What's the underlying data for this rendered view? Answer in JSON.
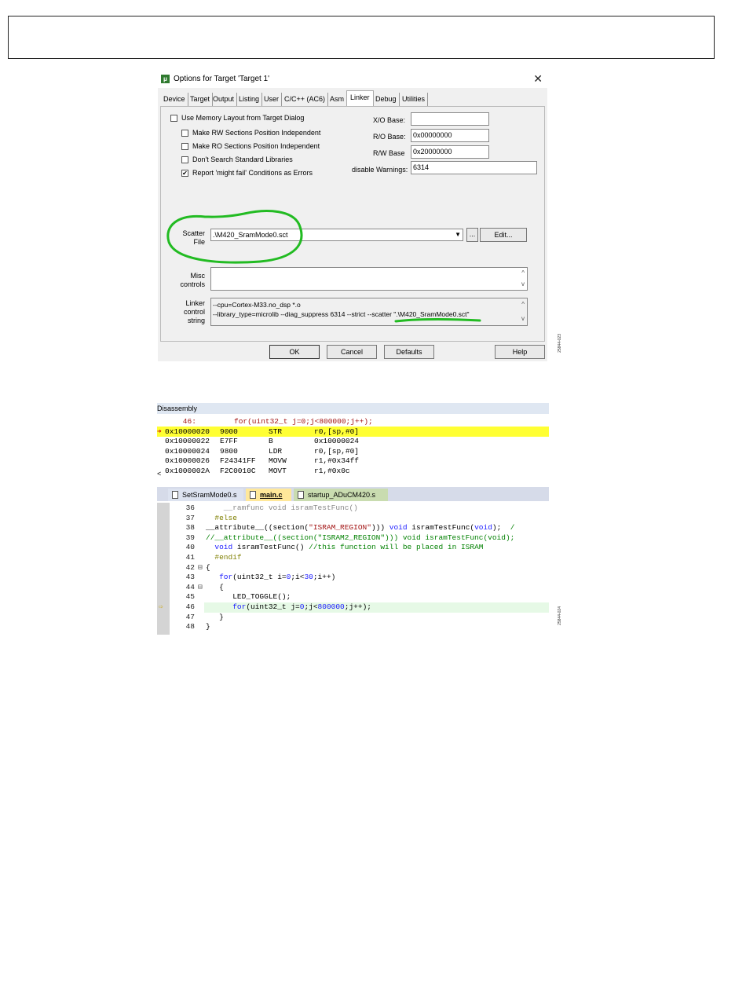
{
  "dialog": {
    "title": "Options for Target 'Target 1'",
    "close_glyph": "✕",
    "tabs": [
      "Device",
      "Target",
      "Output",
      "Listing",
      "User",
      "C/C++ (AC6)",
      "Asm",
      "Linker",
      "Debug",
      "Utilities"
    ],
    "active_tab": "Linker",
    "checkboxes": [
      {
        "label": "Use Memory Layout from Target Dialog",
        "checked": false
      },
      {
        "label": "Make RW Sections Position Independent",
        "checked": false
      },
      {
        "label": "Make RO Sections Position Independent",
        "checked": false
      },
      {
        "label": "Don't Search Standard Libraries",
        "checked": false
      },
      {
        "label": "Report 'might fail' Conditions as Errors",
        "checked": true
      }
    ],
    "check_glyph": "✔",
    "xo_base_label": "X/O Base:",
    "xo_base_value": "",
    "ro_base_label": "R/O Base:",
    "ro_base_value": "0x00000000",
    "rw_base_label": "R/W Base",
    "rw_base_value": "0x20000000",
    "disable_warnings_label": "disable Warnings:",
    "disable_warnings_value": "6314",
    "scatter_label_1": "Scatter",
    "scatter_label_2": "File",
    "scatter_value": ".\\M420_SramMode0.sct",
    "browse_label": "...",
    "edit_label": "Edit...",
    "misc_label_1": "Misc",
    "misc_label_2": "controls",
    "linker_label_1": "Linker",
    "linker_label_2": "control",
    "linker_label_3": "string",
    "linker_line_1": "--cpu=Cortex-M33.no_dsp *.o",
    "linker_line_2": "--library_type=microlib --diag_suppress 6314 --strict --scatter \".\\M420_SramMode0.sct\"",
    "ok_label": "OK",
    "cancel_label": "Cancel",
    "defaults_label": "Defaults",
    "help_label": "Help",
    "annotation_color": "#22bb22"
  },
  "fig_code_1": "25844-023",
  "disassembly": {
    "title": "Disassembly",
    "rows": [
      {
        "addr": "    46:",
        "hex": "",
        "op": "for(uint32_t j=0;j<800000;j++);",
        "arg": "",
        "source": true
      },
      {
        "addr": "0x10000020",
        "hex": "9000",
        "op": "STR",
        "arg": "r0,[sp,#0]",
        "current": true
      },
      {
        "addr": "0x10000022",
        "hex": "E7FF",
        "op": "B",
        "arg": "0x10000024"
      },
      {
        "addr": "0x10000024",
        "hex": "9800",
        "op": "LDR",
        "arg": "r0,[sp,#0]"
      },
      {
        "addr": "0x10000026",
        "hex": "F24341FF",
        "op": "MOVW",
        "arg": "r1,#0x34ff"
      },
      {
        "addr": "0x1000002A",
        "hex": "F2C0010C",
        "op": "MOVT",
        "arg": "r1,#0x0c"
      }
    ],
    "scroll_left_glyph": "<"
  },
  "editor": {
    "tabs": [
      {
        "label": "SetSramMode0.s",
        "active": false
      },
      {
        "label": "main.c",
        "active": true
      },
      {
        "label": "startup_ADuCM420.s",
        "active": false
      }
    ],
    "lines": [
      {
        "n": "36",
        "fold": "",
        "code": [
          [
            "gray",
            "    __ramfunc "
          ],
          [
            "gray",
            "void "
          ],
          [
            "gray",
            "isramTestFunc()"
          ]
        ]
      },
      {
        "n": "37",
        "fold": "",
        "code": [
          [
            "pp",
            "  #else"
          ]
        ]
      },
      {
        "n": "38",
        "fold": "",
        "code": [
          [
            "",
            "__attribute__((section("
          ],
          [
            "str",
            "\"ISRAM_REGION\""
          ],
          [
            "",
            ")))"
          ],
          [
            "kw",
            " void"
          ],
          [
            "",
            " isramTestFunc("
          ],
          [
            "kw",
            "void"
          ],
          [
            "",
            ");  "
          ],
          [
            "cm",
            "/"
          ]
        ]
      },
      {
        "n": "39",
        "fold": "",
        "code": [
          [
            "cm",
            "//__attribute__((section(\"ISRAM2_REGION\"))) void isramTestFunc(void);"
          ]
        ]
      },
      {
        "n": "40",
        "fold": "",
        "code": [
          [
            "kw",
            "  void"
          ],
          [
            "",
            " isramTestFunc() "
          ],
          [
            "cm",
            "//this function will be placed in ISRAM"
          ]
        ]
      },
      {
        "n": "41",
        "fold": "",
        "code": [
          [
            "pp",
            "  #endif"
          ]
        ]
      },
      {
        "n": "42",
        "fold": "⊟",
        "code": [
          [
            "",
            "{"
          ]
        ]
      },
      {
        "n": "43",
        "fold": "",
        "code": [
          [
            "kw",
            "   for"
          ],
          [
            "",
            "(uint32_t i="
          ],
          [
            "num",
            "0"
          ],
          [
            "",
            ";i<"
          ],
          [
            "num",
            "30"
          ],
          [
            "",
            ";i++)"
          ]
        ]
      },
      {
        "n": "44",
        "fold": "⊟",
        "code": [
          [
            "",
            "   {"
          ]
        ]
      },
      {
        "n": "45",
        "fold": "",
        "code": [
          [
            "",
            "      LED_TOGGLE();"
          ]
        ]
      },
      {
        "n": "46",
        "fold": "",
        "code": [
          [
            "kw",
            "      for"
          ],
          [
            "",
            "(uint32_t j="
          ],
          [
            "num",
            "0"
          ],
          [
            "",
            ";j<"
          ],
          [
            "num",
            "800000"
          ],
          [
            "",
            ";j++);"
          ]
        ],
        "current": true
      },
      {
        "n": "47",
        "fold": "",
        "code": [
          [
            "",
            "   }"
          ]
        ]
      },
      {
        "n": "48",
        "fold": "",
        "code": [
          [
            "",
            "}"
          ]
        ]
      }
    ]
  },
  "fig_code_2": "25844-024"
}
